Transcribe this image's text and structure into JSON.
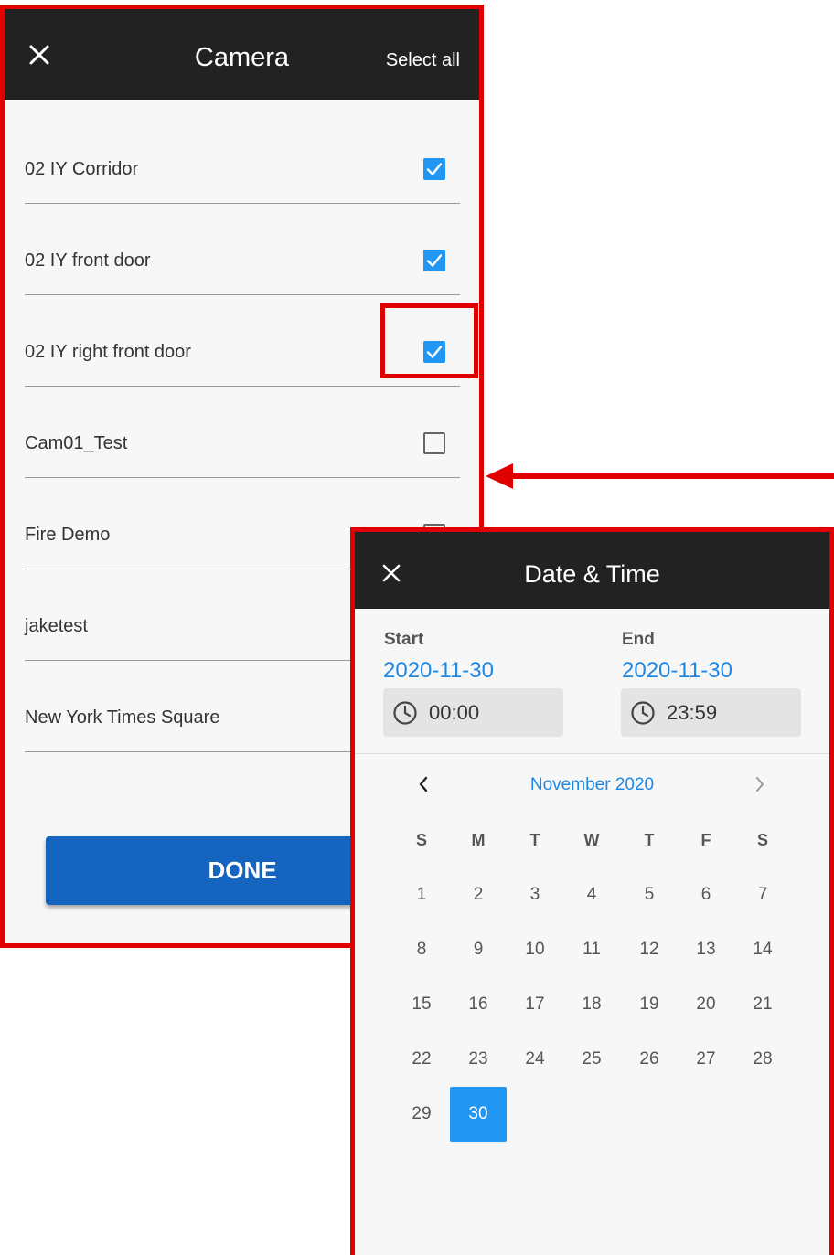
{
  "camera": {
    "title": "Camera",
    "select_all": "Select all",
    "items": [
      {
        "label": "02 IY Corridor",
        "checked": true
      },
      {
        "label": "02 IY front door",
        "checked": true
      },
      {
        "label": "02 IY right front door",
        "checked": true
      },
      {
        "label": "Cam01_Test",
        "checked": false
      },
      {
        "label": "Fire Demo",
        "checked": false
      },
      {
        "label": "jaketest",
        "checked": false
      },
      {
        "label": "New York Times Square",
        "checked": false
      }
    ],
    "done_label": "DONE"
  },
  "date_time": {
    "title": "Date & Time",
    "start": {
      "label": "Start",
      "date": "2020-11-30",
      "time": "00:00"
    },
    "end": {
      "label": "End",
      "date": "2020-11-30",
      "time": "23:59"
    },
    "month_title": "November 2020",
    "weekdays": [
      "S",
      "M",
      "T",
      "W",
      "T",
      "F",
      "S"
    ],
    "first_weekday_index": 0,
    "days_in_month": 30,
    "selected_day": 30
  },
  "colors": {
    "annotation_red": "#e00000",
    "header_dark": "#222222",
    "accent_blue": "#2196f3",
    "done_blue": "#1565c0"
  },
  "icons": {
    "close": "close-icon",
    "check": "checkmark-icon",
    "clock": "clock-icon",
    "prev": "chevron-left-icon",
    "next": "chevron-right-icon"
  }
}
